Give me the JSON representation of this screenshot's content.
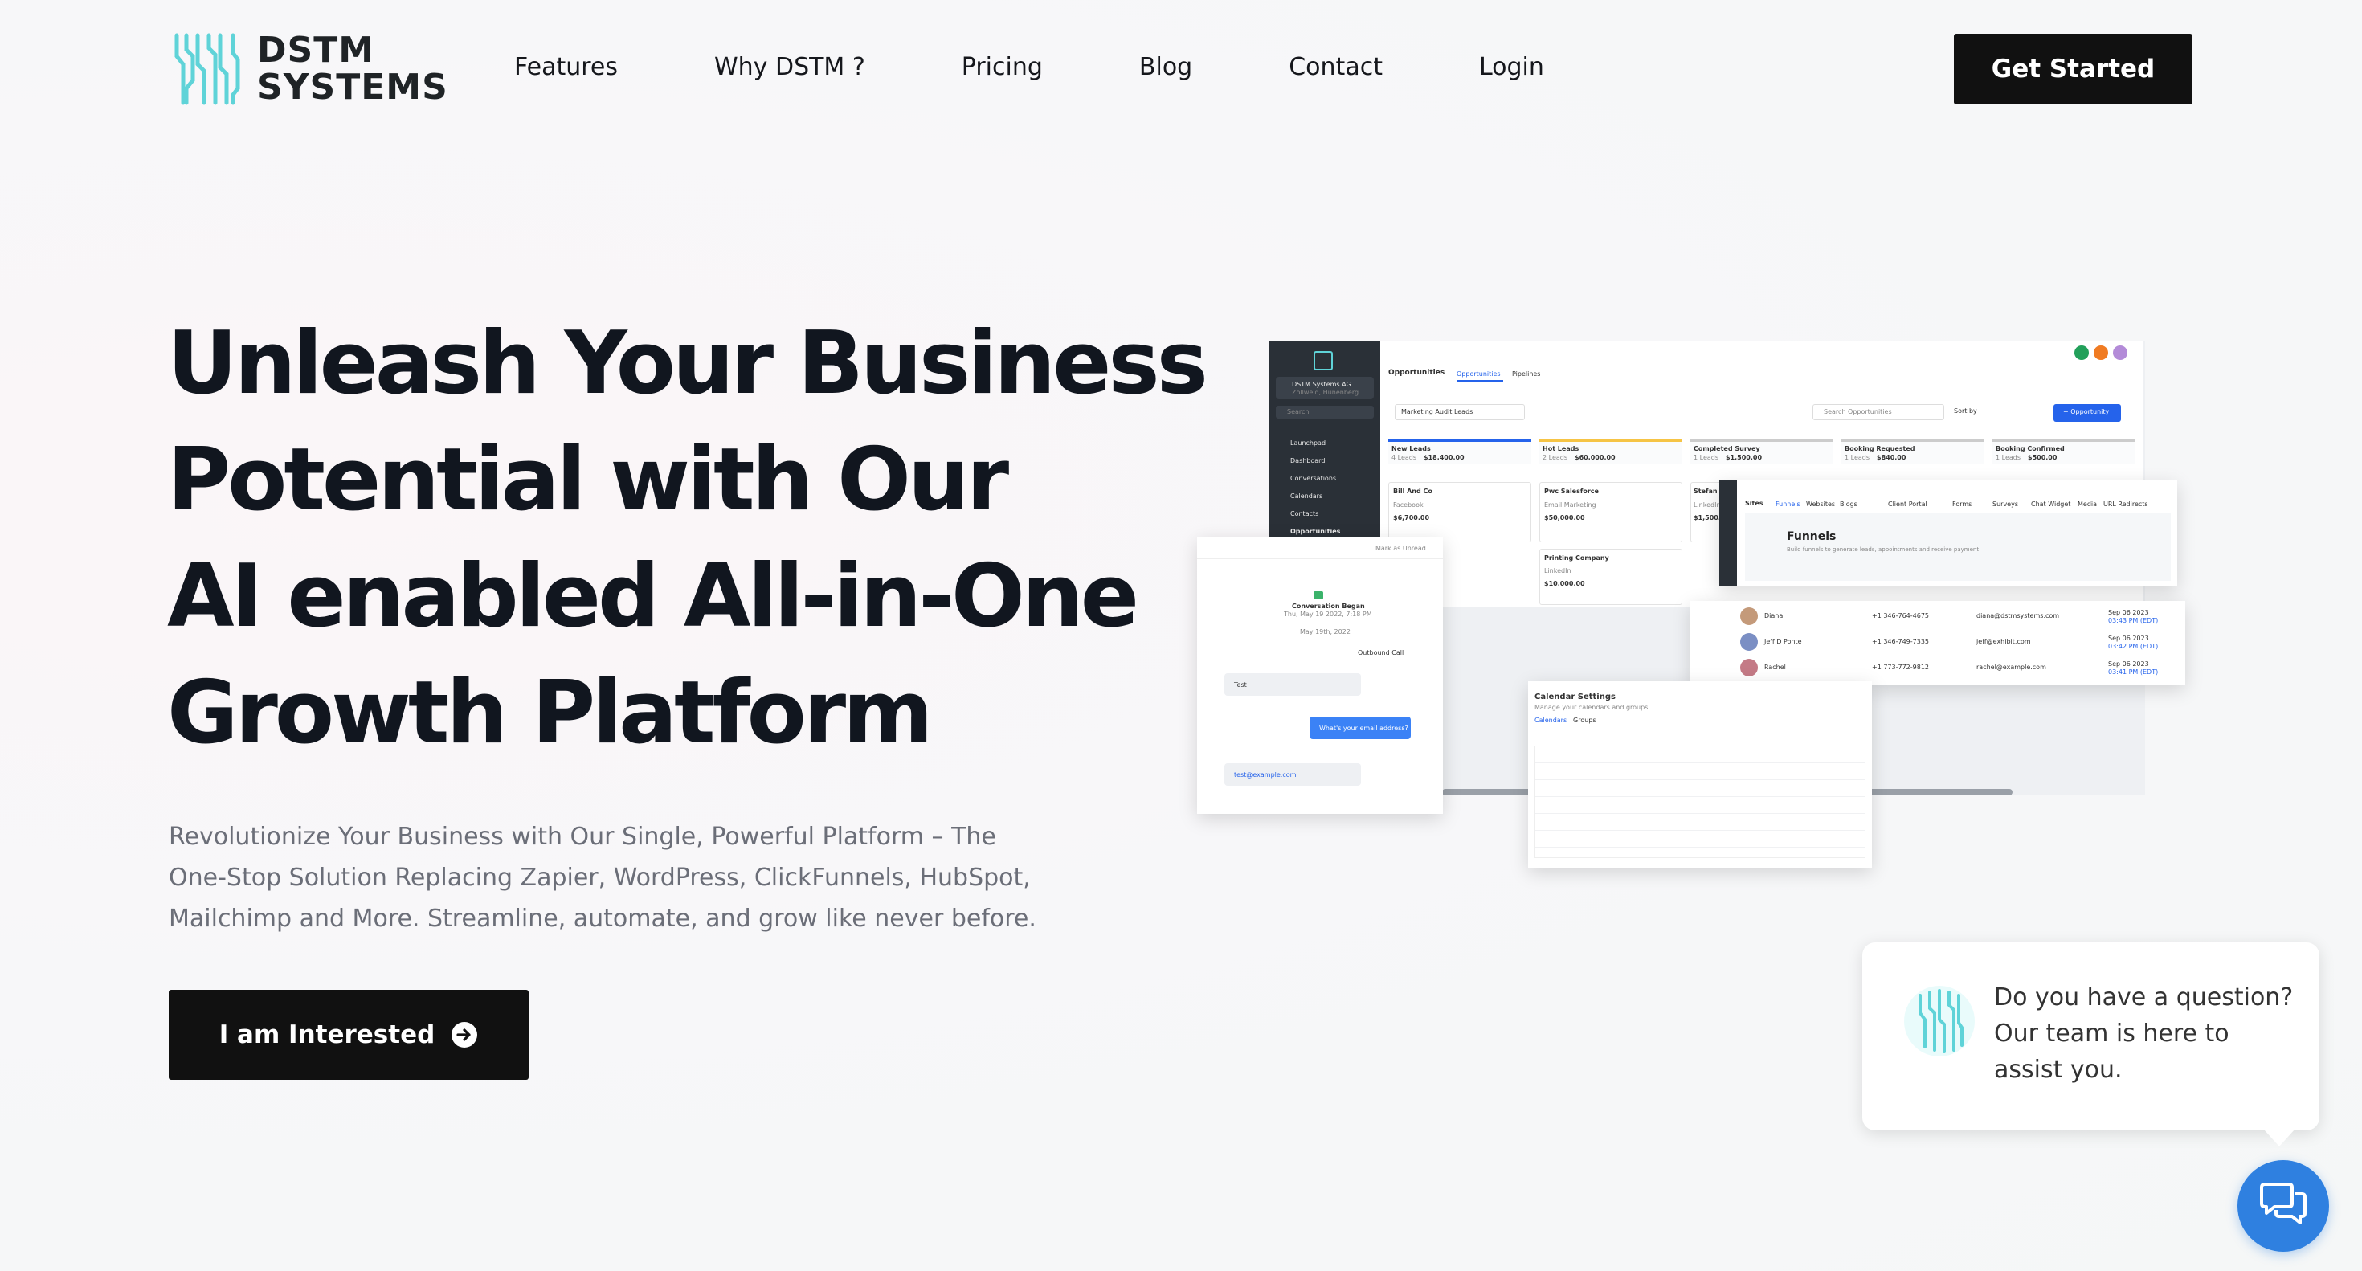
{
  "brand": {
    "name_line1": "DSTM",
    "name_line2": "SYSTEMS",
    "accent_color": "#5fd3d8"
  },
  "nav": {
    "items": [
      {
        "label": "Features"
      },
      {
        "label": "Why DSTM ?"
      },
      {
        "label": "Pricing"
      },
      {
        "label": "Blog"
      },
      {
        "label": "Contact"
      },
      {
        "label": "Login"
      }
    ],
    "cta_label": "Get Started"
  },
  "hero": {
    "title_lines": [
      "Unleash Your Business",
      "Potential with Our",
      "AI enabled All-in-One",
      "Growth Platform"
    ],
    "subtitle_lines": [
      "Revolutionize Your Business with Our Single, Powerful Platform – The",
      "One-Stop Solution Replacing Zapier, WordPress, ClickFunnels, HubSpot,",
      "Mailchimp and More. Streamline, automate, and grow like never before."
    ],
    "button_label": "I am Interested",
    "button_icon": "arrow-circle-right-icon"
  },
  "mockup": {
    "sidebar": {
      "account": "DSTM Systems AG",
      "account_sub": "Zollweid, Hünenberg...",
      "search": "Search",
      "items": [
        "Launchpad",
        "Dashboard",
        "Conversations",
        "Calendars",
        "Contacts",
        "Opportunities"
      ]
    },
    "opportunities": {
      "title": "Opportunities",
      "tabs": [
        "Opportunities",
        "Pipelines"
      ],
      "pipeline": "Marketing Audit Leads",
      "search_placeholder": "Search Opportunities",
      "sort": "Sort by",
      "add_button": "+ Opportunity",
      "stages": [
        {
          "name": "New Leads",
          "count": "4 Leads",
          "value": "$18,400.00"
        },
        {
          "name": "Hot Leads",
          "count": "2 Leads",
          "value": "$60,000.00"
        },
        {
          "name": "Completed Survey",
          "count": "1 Leads",
          "value": "$1,500.00"
        },
        {
          "name": "Booking Requested",
          "count": "1 Leads",
          "value": "$840.00"
        },
        {
          "name": "Booking Confirmed",
          "count": "1 Leads",
          "value": "$500.00"
        }
      ],
      "cards": [
        {
          "name": "Bill And Co",
          "source": "Facebook",
          "value": "$6,700.00"
        },
        {
          "name": "Pwc Salesforce",
          "source": "Email Marketing",
          "value": "$50,000.00"
        },
        {
          "name": "Stefan",
          "source": "LinkedIn",
          "value": "$1,500.00"
        },
        {
          "name": "Printing Company",
          "source": "LinkedIn",
          "value": "$10,000.00"
        }
      ]
    },
    "sites": {
      "title": "Sites",
      "tabs": [
        "Funnels",
        "Websites",
        "Blogs",
        "Client Portal",
        "Forms",
        "Surveys",
        "Chat Widget",
        "Media",
        "URL Redirects"
      ],
      "heading": "Funnels",
      "description": "Build funnels to generate leads, appointments and receive payment"
    },
    "contacts": [
      {
        "name": "Diana",
        "phone": "+1 346-764-4675",
        "email": "diana@dstmsystems.com",
        "date": "Sep 06 2023",
        "time": "03:43 PM (EDT)"
      },
      {
        "name": "Jeff D Ponte",
        "phone": "+1 346-749-7335",
        "email": "jeff@exhibit.com",
        "date": "Sep 06 2023",
        "time": "03:42 PM (EDT)"
      },
      {
        "name": "Rachel",
        "phone": "+1 773-772-9812",
        "email": "rachel@example.com",
        "date": "Sep 06 2023",
        "time": "03:41 PM (EDT)"
      }
    ],
    "conversation": {
      "header": "Mark as Unread",
      "started": "Conversation Began",
      "started_date": "Thu, May 19 2022, 7:18 PM",
      "date_pill": "May 19th, 2022",
      "call": "Outbound Call",
      "msg_in": "Test",
      "msg_out": "What's your email address?",
      "msg_email": "test@example.com"
    },
    "calendar": {
      "title": "Calendar Settings",
      "subtitle": "Manage your calendars and groups",
      "tabs": [
        "Calendars",
        "Groups"
      ]
    }
  },
  "chat": {
    "lines": [
      "Do you have a question?",
      "Our team is here to",
      "assist you."
    ],
    "fab_color": "#2f80e0"
  }
}
